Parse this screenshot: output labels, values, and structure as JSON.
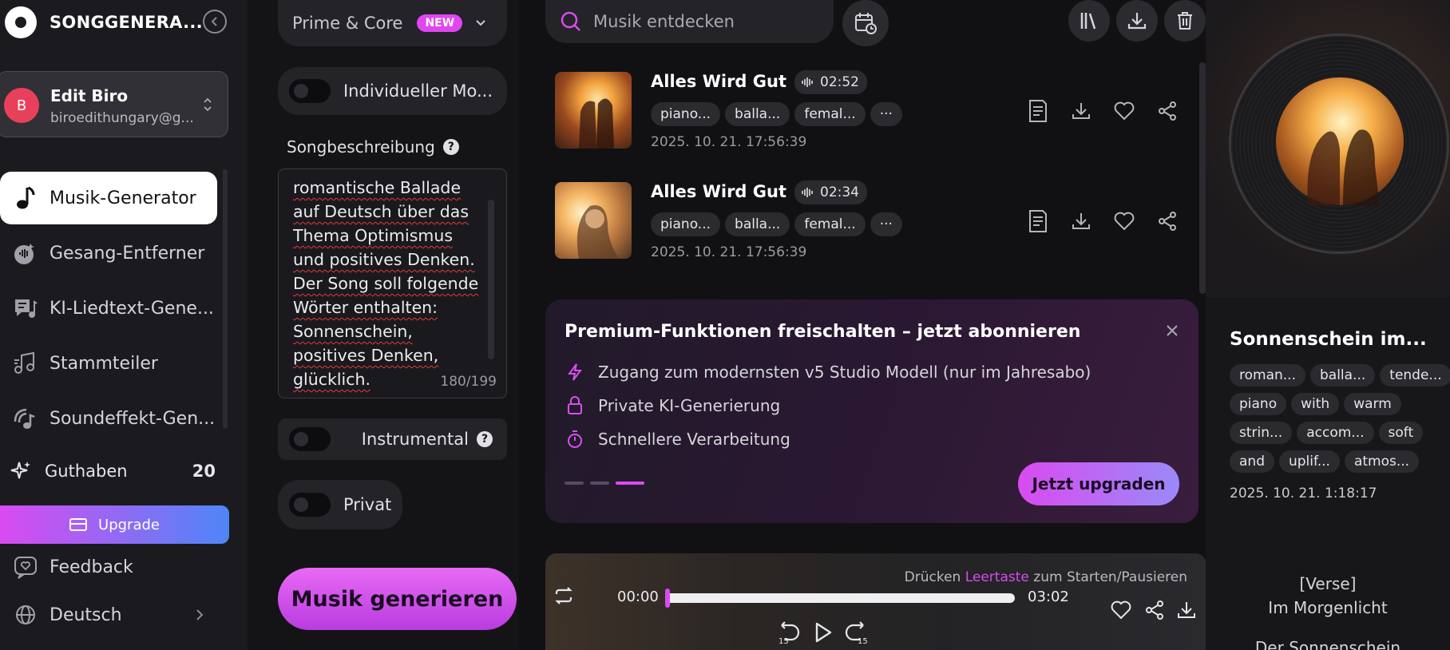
{
  "sidebar": {
    "brand": "SONGGENERA...",
    "account": {
      "initial": "B",
      "name": "Edit Biro",
      "email": "biroedithungary@g..."
    },
    "nav": [
      {
        "label": "Musik-Generator",
        "icon": "music-note-icon"
      },
      {
        "label": "Gesang-Entferner",
        "icon": "vocal-remover-icon"
      },
      {
        "label": "KI-Liedtext-Gene...",
        "icon": "lyrics-icon"
      },
      {
        "label": "Stammteiler",
        "icon": "stem-splitter-icon"
      },
      {
        "label": "Soundeffekt-Gen...",
        "icon": "sound-effect-icon"
      }
    ],
    "credits_label": "Guthaben",
    "credits_value": "20",
    "upgrade_label": "Upgrade",
    "feedback_label": "Feedback",
    "language_label": "Deutsch"
  },
  "settings": {
    "model": "Prime & Core",
    "model_badge": "NEW",
    "custom_mode_label": "Individueller Mo...",
    "song_desc_label": "Songbeschreibung",
    "song_desc_text": "romantische Ballade auf Deutsch über das Thema Optimismus und positives Denken. Der Song soll folgende Wörter enthalten: Sonnenschein, positives Denken, glücklich.",
    "char_count": "180/199",
    "instrumental_label": "Instrumental",
    "private_label": "Privat",
    "generate_label": "Musik generieren"
  },
  "main": {
    "search_placeholder": "Musik entdecken",
    "songs": [
      {
        "title": "Alles Wird Gut",
        "duration": "02:52",
        "tags": [
          "piano...",
          "balla...",
          "femal...",
          "···"
        ],
        "date": "2025. 10. 21. 17:56:39"
      },
      {
        "title": "Alles Wird Gut",
        "duration": "02:34",
        "tags": [
          "piano...",
          "balla...",
          "femal...",
          "···"
        ],
        "date": "2025. 10. 21. 17:56:39"
      }
    ],
    "promo": {
      "title": "Premium-Funktionen freischalten – jetzt abonnieren",
      "features": [
        "Zugang zum modernsten v5 Studio Modell (nur im Jahresabo)",
        "Private KI-Generierung",
        "Schnellere Verarbeitung"
      ],
      "cta": "Jetzt upgraden"
    },
    "player": {
      "hint_pre": "Drücken ",
      "hint_key": "Leertaste",
      "hint_post": " zum Starten/Pausieren",
      "current_time": "00:00",
      "total_time": "03:02",
      "progress": 0.0,
      "skip_back_label": "15",
      "skip_forward_label": "15"
    }
  },
  "detail": {
    "title": "Sonnenschein im...",
    "tags": [
      "roman...",
      "balla...",
      "tende...",
      "piano",
      "with",
      "warm",
      "strin...",
      "accom...",
      "soft",
      "and",
      "uplif...",
      "atmos..."
    ],
    "date": "2025. 10. 21. 1:18:17",
    "lyrics": [
      "[Verse]",
      "Im Morgenlicht",
      "Der Sonnenschein"
    ]
  },
  "colors": {
    "accent": "#d94bf0",
    "accent_blue": "#4f86f7",
    "avatar": "#e8405a"
  }
}
